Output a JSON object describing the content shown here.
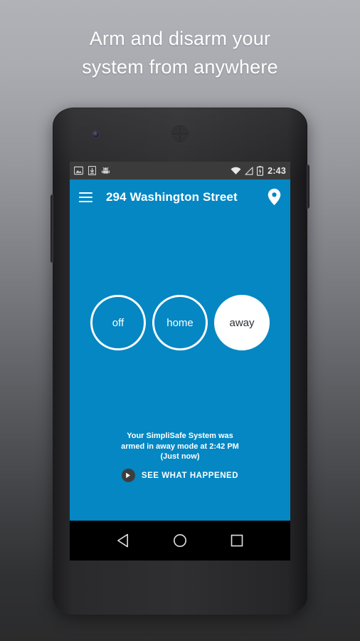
{
  "headline": {
    "line1": "Arm and disarm your",
    "line2": "system from anywhere"
  },
  "colors": {
    "brand_blue": "#0487C3",
    "appbar_blue": "#0487C3",
    "statusbar_gray": "#3B3B3B",
    "navbar_black": "#000000",
    "white": "#FFFFFF",
    "away_text": "#2B2F33",
    "play_circle": "#3D3D3D"
  },
  "statusbar": {
    "left_icons": [
      "image-icon",
      "download-icon",
      "android-icon"
    ],
    "right_icons": [
      "wifi-icon",
      "cell-signal-icon",
      "battery-charging-icon"
    ],
    "time": "2:43"
  },
  "appbar": {
    "menu_icon": "hamburger-menu-icon",
    "title": "294 Washington Street",
    "location_icon": "location-pin-icon"
  },
  "modes": [
    {
      "label": "off",
      "state": "inactive"
    },
    {
      "label": "home",
      "state": "inactive"
    },
    {
      "label": "away",
      "state": "active"
    }
  ],
  "status_message": {
    "line1": "Your SimpliSafe System was",
    "line2": "armed in away mode at 2:42 PM",
    "line3": "(Just now)"
  },
  "see_what_happened": {
    "icon": "play-icon",
    "label": "SEE WHAT HAPPENED"
  },
  "navbar": {
    "back": "back-triangle-icon",
    "home": "home-circle-icon",
    "recents": "recents-square-icon"
  }
}
